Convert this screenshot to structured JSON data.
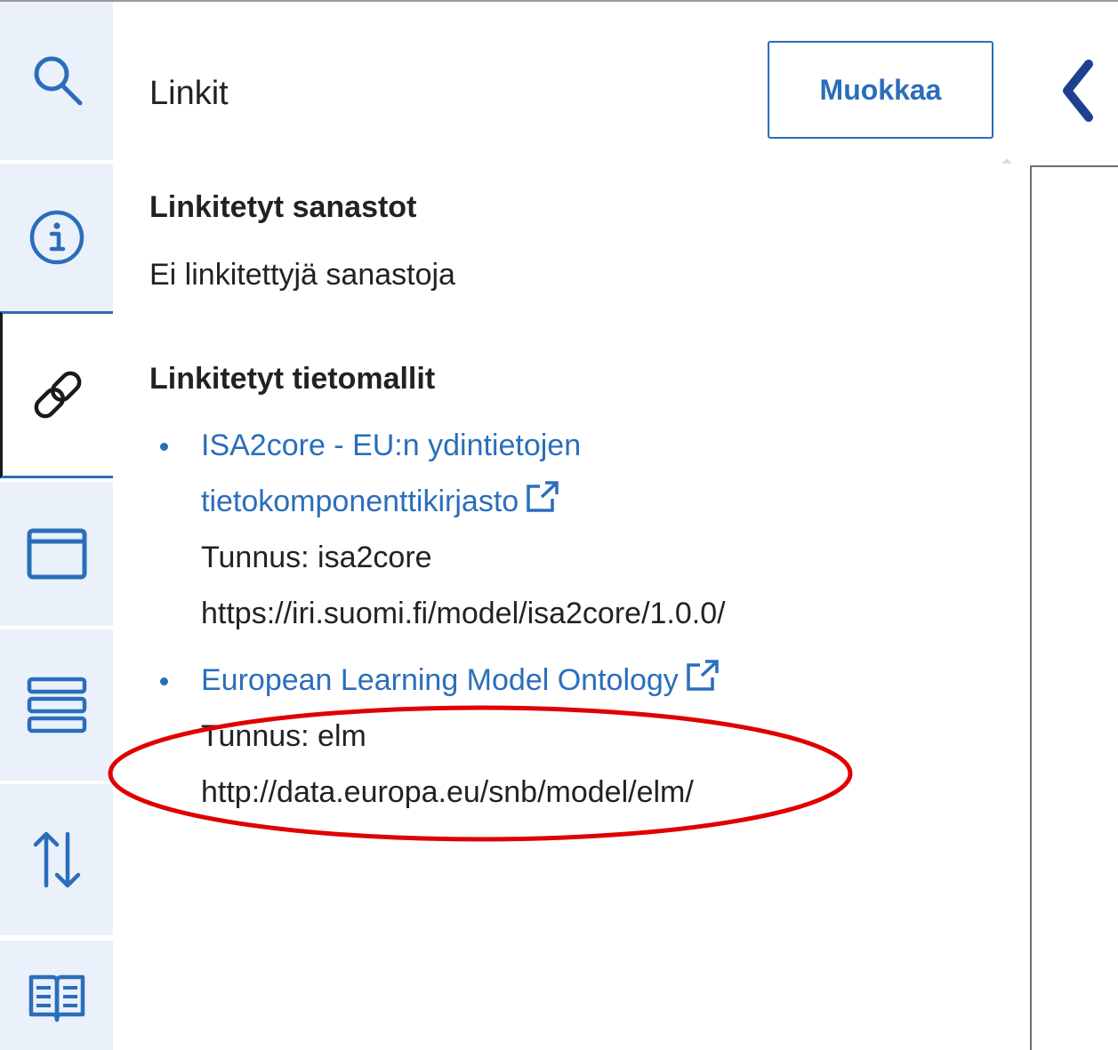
{
  "panel": {
    "title": "Linkit",
    "edit_label": "Muokkaa"
  },
  "sidebar": {
    "items": [
      {
        "icon": "search-icon"
      },
      {
        "icon": "info-icon"
      },
      {
        "icon": "link-icon",
        "active": true
      },
      {
        "icon": "window-icon"
      },
      {
        "icon": "list-icon"
      },
      {
        "icon": "sort-icon"
      },
      {
        "icon": "book-icon"
      }
    ]
  },
  "linked_vocabularies": {
    "heading": "Linkitetyt sanastot",
    "empty_text": "Ei linkitettyjä sanastoja"
  },
  "linked_models": {
    "heading": "Linkitetyt tietomallit",
    "items": [
      {
        "title_line1": "ISA2core - EU:n ydintietojen",
        "title_line2": "tietokomponenttikirjasto",
        "identifier": "Tunnus: isa2core",
        "uri": "https://iri.suomi.fi/model/isa2core/1.0.0/"
      },
      {
        "title_line1": "European Learning Model Ontology",
        "identifier": "Tunnus: elm",
        "uri": "http://data.europa.eu/snb/model/elm/"
      }
    ]
  },
  "colors": {
    "accent": "#2a6ebb",
    "rail_background": "#eaf1fa",
    "annotation": "#e00000"
  }
}
